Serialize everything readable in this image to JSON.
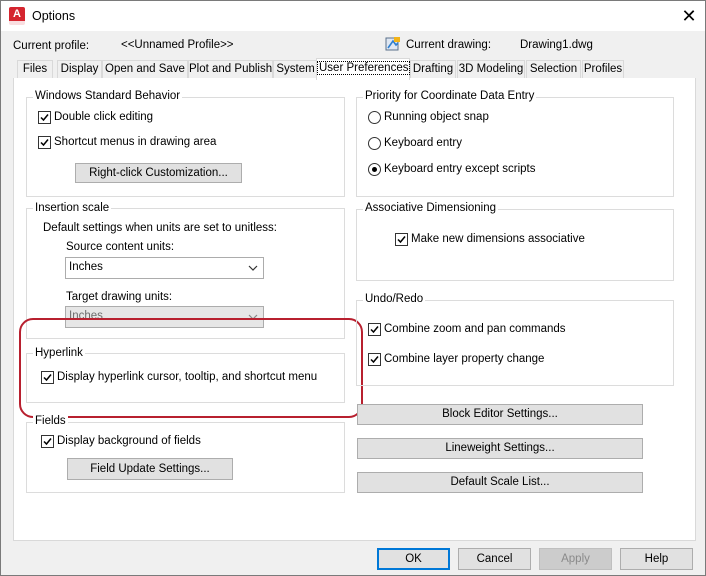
{
  "window": {
    "title": "Options",
    "close_glyph": "✕"
  },
  "header": {
    "current_profile_label": "Current profile:",
    "current_profile_value": "<<Unnamed Profile>>",
    "current_drawing_label": "Current drawing:",
    "current_drawing_value": "Drawing1.dwg"
  },
  "tabs": [
    "Files",
    "Display",
    "Open and Save",
    "Plot and Publish",
    "System",
    "User Preferences",
    "Drafting",
    "3D Modeling",
    "Selection",
    "Profiles"
  ],
  "active_tab": "User Preferences",
  "windows_std": {
    "title": "Windows Standard Behavior",
    "double_click": "Double click editing",
    "shortcut_menus": "Shortcut menus in drawing area",
    "right_click_button": "Right-click Customization..."
  },
  "insertion": {
    "title": "Insertion scale",
    "desc": "Default settings when units are set to unitless:",
    "source_label": "Source content units:",
    "source_value": "Inches",
    "target_label": "Target drawing units:",
    "target_value": "Inches"
  },
  "hyperlink": {
    "title": "Hyperlink",
    "display": "Display hyperlink cursor, tooltip, and shortcut menu"
  },
  "fields": {
    "title": "Fields",
    "display_bg": "Display background of fields",
    "update_button": "Field Update Settings..."
  },
  "priority": {
    "title": "Priority for Coordinate Data Entry",
    "options": [
      "Running object snap",
      "Keyboard entry",
      "Keyboard entry except scripts"
    ],
    "selected": "Keyboard entry except scripts"
  },
  "assoc": {
    "title": "Associative Dimensioning",
    "make_assoc": "Make new dimensions associative"
  },
  "undo": {
    "title": "Undo/Redo",
    "combine_zoom": "Combine zoom and pan commands",
    "combine_layer": "Combine layer property change"
  },
  "right_buttons": {
    "block_editor": "Block Editor Settings...",
    "lineweight": "Lineweight Settings...",
    "default_scale": "Default Scale List..."
  },
  "footer": {
    "ok": "OK",
    "cancel": "Cancel",
    "apply": "Apply",
    "help": "Help"
  },
  "colors": {
    "highlight": "#b8202f",
    "accent": "#0078d7",
    "app_icon": "#d5252f"
  }
}
